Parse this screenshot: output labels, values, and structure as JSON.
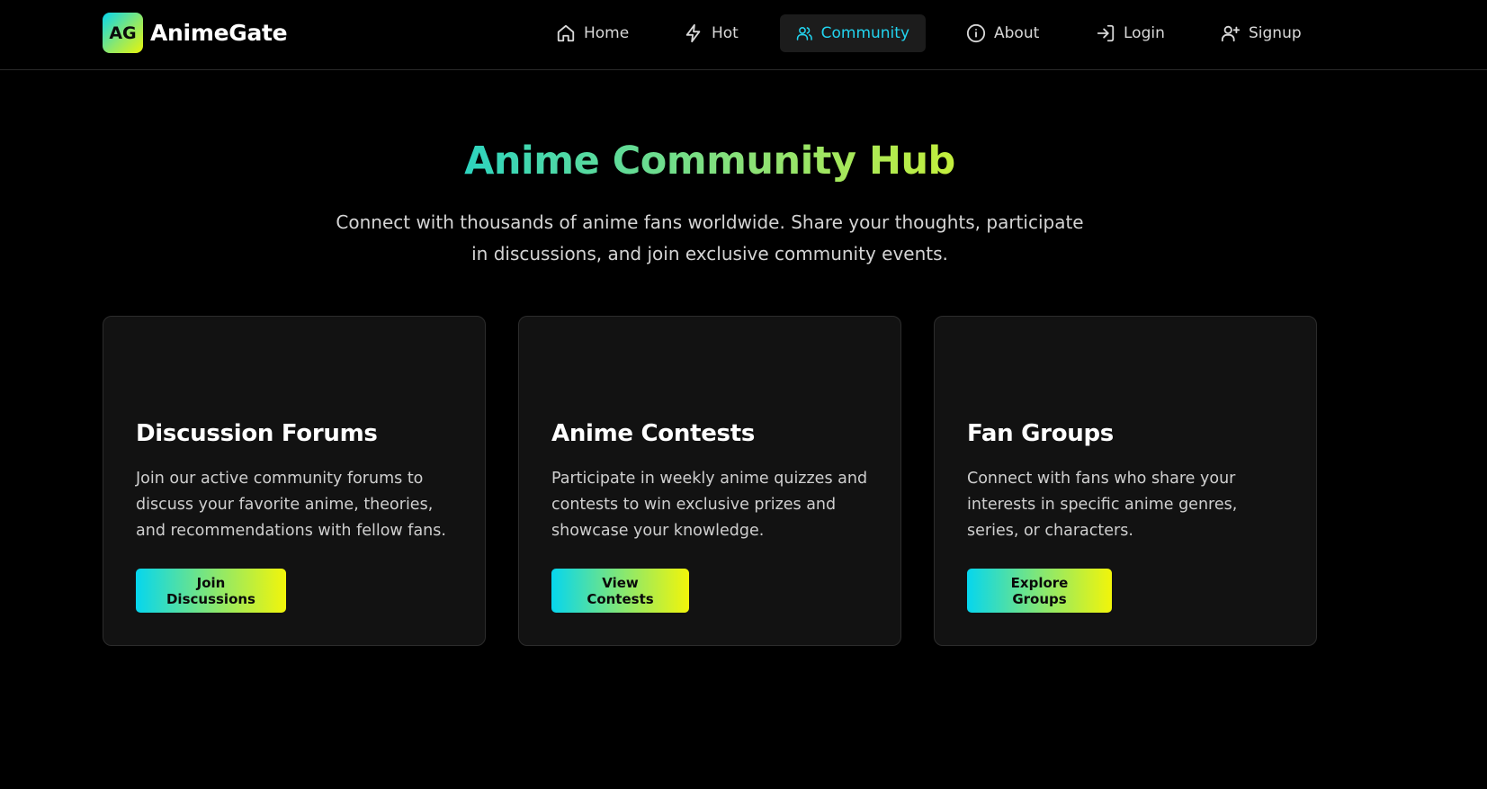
{
  "brand": {
    "logo_text": "AG",
    "name": "AnimeGate"
  },
  "nav": {
    "items": [
      {
        "label": "Home",
        "icon": "home-icon"
      },
      {
        "label": "Hot",
        "icon": "lightning-icon"
      },
      {
        "label": "Community",
        "icon": "users-icon",
        "active": true
      },
      {
        "label": "About",
        "icon": "info-icon"
      },
      {
        "label": "Login",
        "icon": "login-icon"
      },
      {
        "label": "Signup",
        "icon": "user-plus-icon"
      }
    ]
  },
  "hero": {
    "title": "Anime Community Hub",
    "subtitle": "Connect with thousands of anime fans worldwide. Share your thoughts, participate in discussions, and join exclusive community events."
  },
  "cards": [
    {
      "title": "Discussion Forums",
      "description": "Join our active community forums to discuss your favorite anime, theories, and recommendations with fellow fans.",
      "button": "Join Discussions"
    },
    {
      "title": "Anime Contests",
      "description": "Participate in weekly anime quizzes and contests to win exclusive prizes and showcase your knowledge.",
      "button": "View Contests"
    },
    {
      "title": "Fan Groups",
      "description": "Connect with fans who share your interests in specific anime genres, series, or characters.",
      "button": "Explore Groups"
    }
  ],
  "colors": {
    "background": "#000000",
    "card_background": "#121212",
    "accent": "#22d3ee",
    "gradient_start": "#06d6ee",
    "gradient_end": "#f2f50a"
  }
}
